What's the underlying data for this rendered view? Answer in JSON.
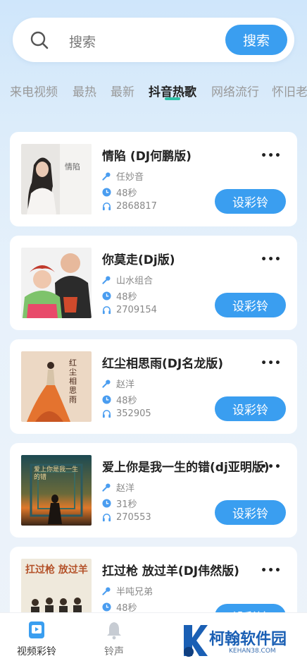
{
  "search": {
    "placeholder": "搜索",
    "button": "搜索"
  },
  "tabs": [
    {
      "label": "来电视频",
      "active": false
    },
    {
      "label": "最热",
      "active": false
    },
    {
      "label": "最新",
      "active": false
    },
    {
      "label": "抖音热歌",
      "active": true
    },
    {
      "label": "网络流行",
      "active": false
    },
    {
      "label": "怀旧老",
      "active": false
    }
  ],
  "songs": [
    {
      "title": "情陷 (DJ何鹏版)",
      "artist": "任妙音",
      "duration": "48秒",
      "plays": "2868817",
      "button": "设彩铃",
      "cover_text": "情陷"
    },
    {
      "title": "你莫走(Dj版)",
      "artist": "山水组合",
      "duration": "48秒",
      "plays": "2709154",
      "button": "设彩铃",
      "cover_text": ""
    },
    {
      "title": "红尘相思雨(DJ名龙版)",
      "artist": "赵洋",
      "duration": "48秒",
      "plays": "352905",
      "button": "设彩铃",
      "cover_text": "红尘相思雨"
    },
    {
      "title": "爱上你是我一生的错(dj亚明版)",
      "artist": "赵洋",
      "duration": "31秒",
      "plays": "270553",
      "button": "设彩铃",
      "cover_text": "爱上你是我一生的错"
    },
    {
      "title": "扛过枪 放过羊(DJ伟然版)",
      "artist": "半吨兄弟",
      "duration": "48秒",
      "plays": "",
      "button": "设彩铃",
      "cover_text": "扛过枪 放过羊"
    }
  ],
  "more_glyph": "•••",
  "bottom_nav": [
    {
      "label": "视频彩铃",
      "icon": "video-ringtone-icon",
      "active": true
    },
    {
      "label": "铃声",
      "icon": "bell-icon",
      "active": false
    }
  ],
  "watermark": {
    "text": "柯翰软件园",
    "sub": "KEHAN38.COM"
  },
  "colors": {
    "accent": "#3a9ef0",
    "indicator": "#2dc1a8"
  }
}
